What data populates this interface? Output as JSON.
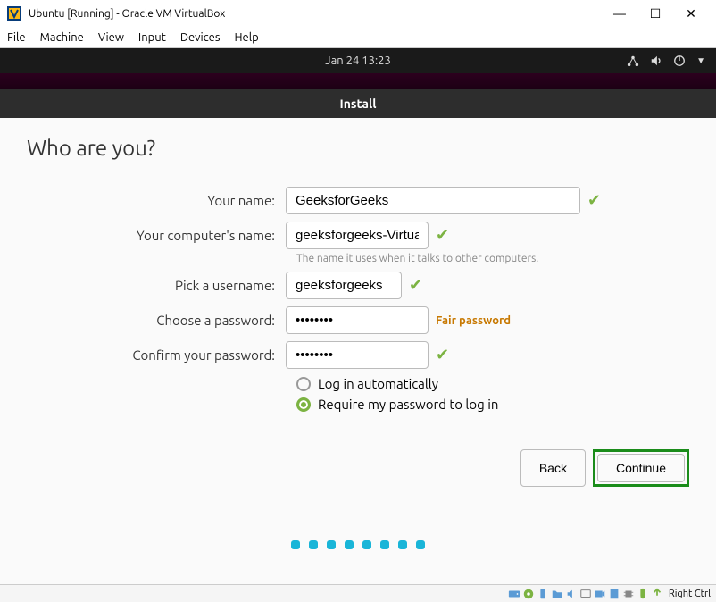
{
  "window": {
    "title": "Ubuntu [Running] - Oracle VM VirtualBox"
  },
  "menubar": [
    "File",
    "Machine",
    "View",
    "Input",
    "Devices",
    "Help"
  ],
  "topbar": {
    "datetime": "Jan 24  13:23"
  },
  "installer": {
    "title": "Install",
    "heading": "Who are you?",
    "labels": {
      "name": "Your name:",
      "computer": "Your computer's name:",
      "computer_hint": "The name it uses when it talks to other computers.",
      "username": "Pick a username:",
      "password": "Choose a password:",
      "password_confirm": "Confirm your password:",
      "auto_login": "Log in automatically",
      "require_pw": "Require my password to log in"
    },
    "values": {
      "name": "GeeksforGeeks",
      "computer": "geeksforgeeks-Virtual",
      "username": "geeksforgeeks",
      "password": "••••••••",
      "password_confirm": "••••••••",
      "password_strength": "Fair password"
    },
    "buttons": {
      "back": "Back",
      "continue": "Continue"
    }
  },
  "statusbar": {
    "right": "Right Ctrl"
  }
}
